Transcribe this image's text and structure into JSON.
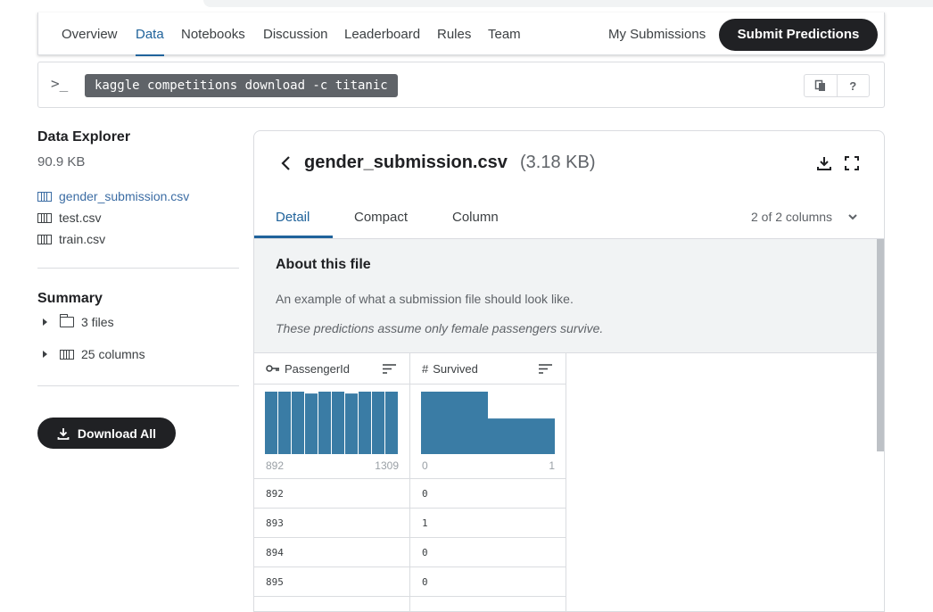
{
  "nav": {
    "tabs": [
      "Overview",
      "Data",
      "Notebooks",
      "Discussion",
      "Leaderboard",
      "Rules",
      "Team"
    ],
    "active_tab": "Data",
    "my_submissions": "My Submissions",
    "submit_predictions": "Submit Predictions"
  },
  "api": {
    "prompt_glyph": ">_",
    "command": "kaggle competitions download -c titanic",
    "help_label": "?"
  },
  "sidebar": {
    "title": "Data Explorer",
    "size": "90.9 KB",
    "files": [
      "gender_submission.csv",
      "test.csv",
      "train.csv"
    ],
    "selected_file": "gender_submission.csv",
    "summary_title": "Summary",
    "summary_files": "3 files",
    "summary_columns": "25 columns",
    "download_all": "Download All"
  },
  "file": {
    "name": "gender_submission.csv",
    "size": "(3.18 KB)",
    "tabs": [
      "Detail",
      "Compact",
      "Column"
    ],
    "active_tab": "Detail",
    "column_count": "2 of 2 columns",
    "about_title": "About this file",
    "description": "An example of what a submission file should look like.",
    "note": "These predictions assume only female passengers survive."
  },
  "columns": [
    {
      "name": "PassengerId",
      "type_icon": "key-icon",
      "hist": [
        1.0,
        1.0,
        1.0,
        0.97,
        1.0,
        1.0,
        0.97,
        1.0,
        1.0,
        1.0
      ],
      "min_label": "892",
      "max_label": "1309",
      "cells": [
        "892",
        "893",
        "894",
        "895"
      ]
    },
    {
      "name": "Survived",
      "type_icon": "hash-icon",
      "hist": [
        1.0,
        0.57
      ],
      "min_label": "0",
      "max_label": "1",
      "cells": [
        "0",
        "1",
        "0",
        "0"
      ]
    }
  ],
  "colors": {
    "accent": "#20639b",
    "histogram": "#3a7ca5",
    "dark_button": "#202124"
  }
}
